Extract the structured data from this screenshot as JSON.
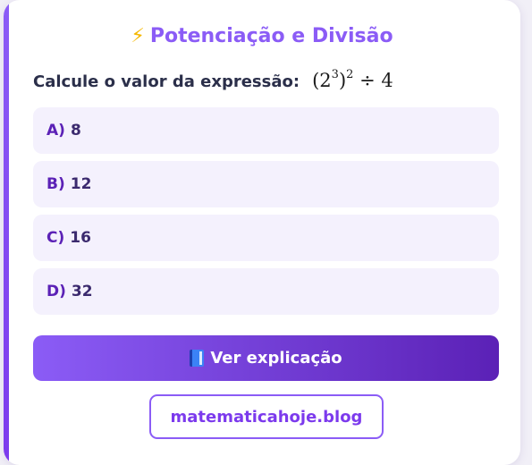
{
  "header": {
    "title_icon": "lightning-bolt-icon",
    "title": "Potenciação e Divisão"
  },
  "question": {
    "prompt": "Calcule o valor da expressão:",
    "expression": {
      "base": "2",
      "inner_exponent": "3",
      "outer_exponent": "2",
      "operator": "÷",
      "divisor": "4"
    }
  },
  "options": [
    {
      "letter": "A)",
      "value": "8"
    },
    {
      "letter": "B)",
      "value": "12"
    },
    {
      "letter": "C)",
      "value": "16"
    },
    {
      "letter": "D)",
      "value": "32"
    }
  ],
  "explain_button": {
    "icon": "blue-book-icon",
    "label": "Ver explicação"
  },
  "footer": {
    "link": "matematicahoje.blog"
  },
  "colors": {
    "accent": "#8b5cf6",
    "accent_dark": "#5b21b6",
    "option_bg": "#f4f1fd",
    "text_dark": "#2b2f4a",
    "bolt": "#f5b800"
  }
}
